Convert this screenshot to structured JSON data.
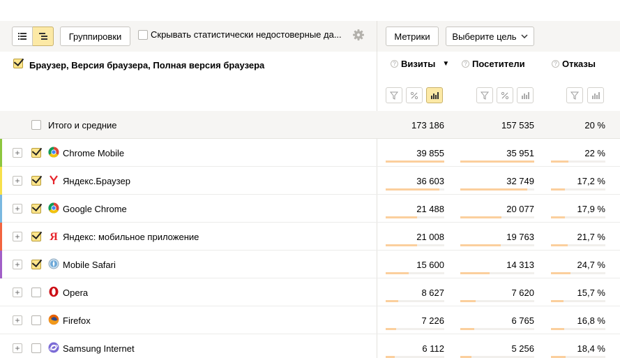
{
  "toolbar": {
    "view_list_icon": "list-icon",
    "view_tree_icon": "tree-icon",
    "groupings_label": "Группировки",
    "hide_unreliable_label": "Скрывать статистически недостоверные да...",
    "hide_unreliable_checked": false,
    "settings_icon": "gear-icon",
    "metrics_label": "Метрики",
    "goal_label": "Выберите цель"
  },
  "dimensions": {
    "title": "Браузер, Версия браузера, Полная версия браузера",
    "checked": true
  },
  "columns": [
    {
      "label": "Визиты",
      "sort": "▼"
    },
    {
      "label": "Посетители"
    },
    {
      "label": "Отказы"
    }
  ],
  "totals": {
    "label": "Итого и средние",
    "visits": "173 186",
    "visitors": "157 535",
    "bounce": "20 %"
  },
  "rows": [
    {
      "name": "Chrome Mobile",
      "icon": "chrome-icon",
      "checked": true,
      "color": "#8dc63f",
      "visits": "39 855",
      "visitors": "35 951",
      "bounce": "22 %",
      "visits_share": 1.0,
      "visitors_share": 1.0,
      "bounce_share": 0.32
    },
    {
      "name": "Яндекс.Браузер",
      "icon": "yandex-browser-icon",
      "checked": true,
      "color": "#f7e04b",
      "visits": "36 603",
      "visitors": "32 749",
      "bounce": "17,2 %",
      "visits_share": 0.92,
      "visitors_share": 0.91,
      "bounce_share": 0.25
    },
    {
      "name": "Google Chrome",
      "icon": "chrome-icon",
      "checked": true,
      "color": "#7ab8e0",
      "visits": "21 488",
      "visitors": "20 077",
      "bounce": "17,9 %",
      "visits_share": 0.54,
      "visitors_share": 0.56,
      "bounce_share": 0.26
    },
    {
      "name": "Яндекс: мобильное приложение",
      "icon": "yandex-app-icon",
      "checked": true,
      "color": "#f26440",
      "visits": "21 008",
      "visitors": "19 763",
      "bounce": "21,7 %",
      "visits_share": 0.53,
      "visitors_share": 0.55,
      "bounce_share": 0.31
    },
    {
      "name": "Mobile Safari",
      "icon": "safari-icon",
      "checked": true,
      "color": "#a15fc7",
      "visits": "15 600",
      "visitors": "14 313",
      "bounce": "24,7 %",
      "visits_share": 0.39,
      "visitors_share": 0.4,
      "bounce_share": 0.36
    },
    {
      "name": "Opera",
      "icon": "opera-icon",
      "checked": false,
      "color": "",
      "visits": "8 627",
      "visitors": "7 620",
      "bounce": "15,7 %",
      "visits_share": 0.22,
      "visitors_share": 0.21,
      "bounce_share": 0.23
    },
    {
      "name": "Firefox",
      "icon": "firefox-icon",
      "checked": false,
      "color": "",
      "visits": "7 226",
      "visitors": "6 765",
      "bounce": "16,8 %",
      "visits_share": 0.18,
      "visitors_share": 0.19,
      "bounce_share": 0.24
    },
    {
      "name": "Samsung Internet",
      "icon": "samsung-internet-icon",
      "checked": false,
      "color": "",
      "visits": "6 112",
      "visitors": "5 256",
      "bounce": "18,4 %",
      "visits_share": 0.15,
      "visitors_share": 0.15,
      "bounce_share": 0.27
    }
  ]
}
